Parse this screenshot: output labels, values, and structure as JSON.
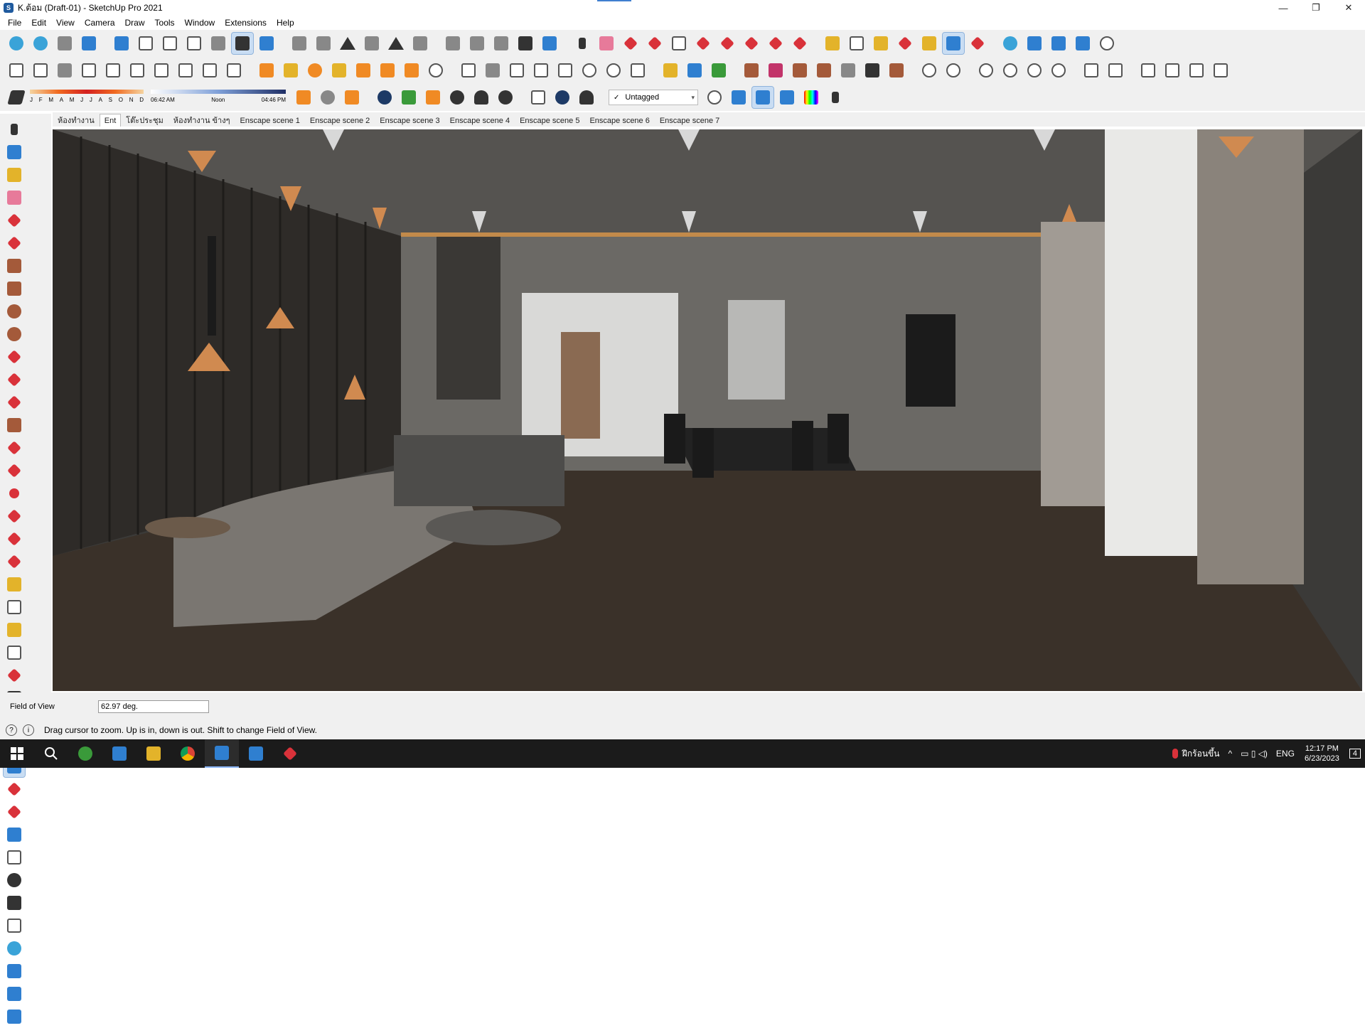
{
  "window": {
    "title": "K.ต้อม (Draft-01) - SketchUp Pro 2021",
    "app_icon_label": "S",
    "controls": {
      "minimize": "—",
      "restore": "❐",
      "close": "✕"
    }
  },
  "menu": [
    "File",
    "Edit",
    "View",
    "Camera",
    "Draw",
    "Tools",
    "Window",
    "Extensions",
    "Help"
  ],
  "shadow": {
    "months": [
      "J",
      "F",
      "M",
      "A",
      "M",
      "J",
      "J",
      "A",
      "S",
      "O",
      "N",
      "D"
    ],
    "time_start": "06:42 AM",
    "time_noon": "Noon",
    "time_end": "04:46 PM"
  },
  "tag": {
    "check": "✓",
    "value": "Untagged",
    "arrow": "▾"
  },
  "scenes": [
    "ห้องทำงาน",
    "Ent",
    "โต๊ะประชุม",
    "ห้องทำงาน ข้างๆ",
    "Enscape scene 1",
    "Enscape scene 2",
    "Enscape scene 3",
    "Enscape scene 4",
    "Enscape scene 5",
    "Enscape scene 6",
    "Enscape scene 7"
  ],
  "active_scene": "Ent",
  "vcb": {
    "label": "Field of View",
    "value": "62.97 deg."
  },
  "status": {
    "icon1": "?",
    "icon2": "i",
    "text": "Drag cursor to zoom.  Up is in, down is out. Shift to change Field of View."
  },
  "taskbar": {
    "weather": "ฝีกร้อนขึ้น",
    "language": "ENG",
    "time": "12:17 PM",
    "date": "6/23/2023",
    "notifications": "4"
  },
  "colors": {
    "accent": "#3f7fd0",
    "selected_tool": "#c9ddf3",
    "viewport_bg": "#3b3a38",
    "taskbar_bg": "#1b1b1b"
  }
}
